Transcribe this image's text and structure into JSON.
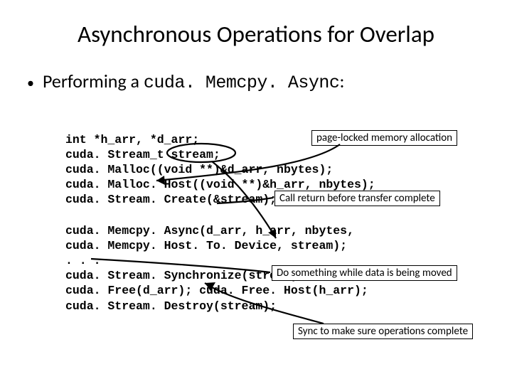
{
  "title": "Asynchronous Operations for Overlap",
  "bullet": {
    "prefix": "Performing a ",
    "code": "cuda. Memcpy. Async",
    "suffix": ":"
  },
  "code": {
    "block1": "int *h_arr, *d_arr;\ncuda. Stream_t stream;\ncuda. Malloc((void **)&d_arr, nbytes);\ncuda. Malloc. Host((void **)&h_arr, nbytes);\ncuda. Stream. Create(&stream);",
    "block2": "cuda. Memcpy. Async(d_arr, h_arr, nbytes,\ncuda. Memcpy. Host. To. Device, stream);\n. . .\ncuda. Stream. Synchronize(stream);\ncuda. Free(d_arr); cuda. Free. Host(h_arr);\ncuda. Stream. Destroy(stream);"
  },
  "callouts": {
    "c1": "page-locked memory allocation",
    "c2": "Call return before transfer complete",
    "c3": "Do something while data is being moved",
    "c4": "Sync to make sure operations complete"
  }
}
